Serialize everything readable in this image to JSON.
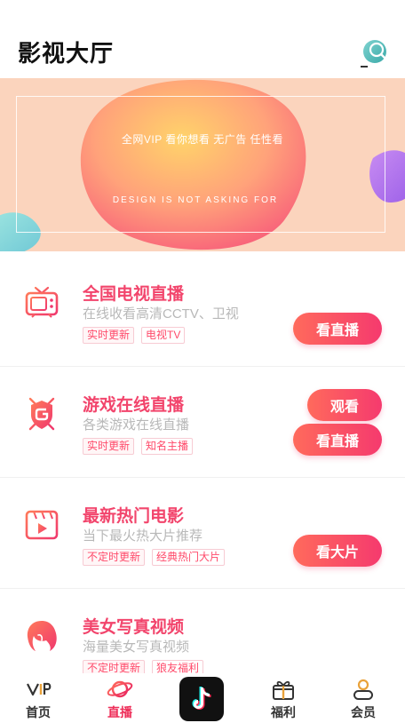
{
  "header": {
    "title": "影视大厅",
    "search_icon": "search-icon"
  },
  "banner": {
    "tagline": "全网VIP 看你想看 无广告 任性看",
    "subtitle": "DESIGN IS NOT ASKING FOR"
  },
  "cards": [
    {
      "title": "全国电视直播",
      "desc": "在线收看高清CCTV、卫视",
      "tags": [
        "实时更新",
        "电视TV"
      ],
      "button": "看直播",
      "icon": "tv-icon"
    },
    {
      "title": "游戏在线直播",
      "desc": "各类游戏在线直播",
      "tags": [
        "实时更新",
        "知名主播"
      ],
      "button": "看直播",
      "icon": "game-shield-icon"
    },
    {
      "title": "最新热门电影",
      "desc": "当下最火热大片推荐",
      "tags": [
        "不定时更新",
        "经典热门大片"
      ],
      "button": "看大片",
      "icon": "film-icon"
    },
    {
      "title": "美女写真视频",
      "desc": "海量美女写真视频",
      "tags": [
        "不定时更新",
        "狼友福利"
      ],
      "button": "观看",
      "icon": "woman-face-icon"
    }
  ],
  "tabbar": {
    "items": [
      {
        "label": "首页",
        "icon": "vip-icon"
      },
      {
        "label": "直播",
        "icon": "planet-icon",
        "active": true
      },
      {
        "label": "",
        "icon": "tiktok-icon"
      },
      {
        "label": "福利",
        "icon": "gift-icon"
      },
      {
        "label": "会员",
        "icon": "user-icon"
      }
    ]
  },
  "colors": {
    "accent": "#f2456c",
    "button_start": "#ff6a5c",
    "button_end": "#f53a6e",
    "banner_bg": "#fbd4bd"
  }
}
